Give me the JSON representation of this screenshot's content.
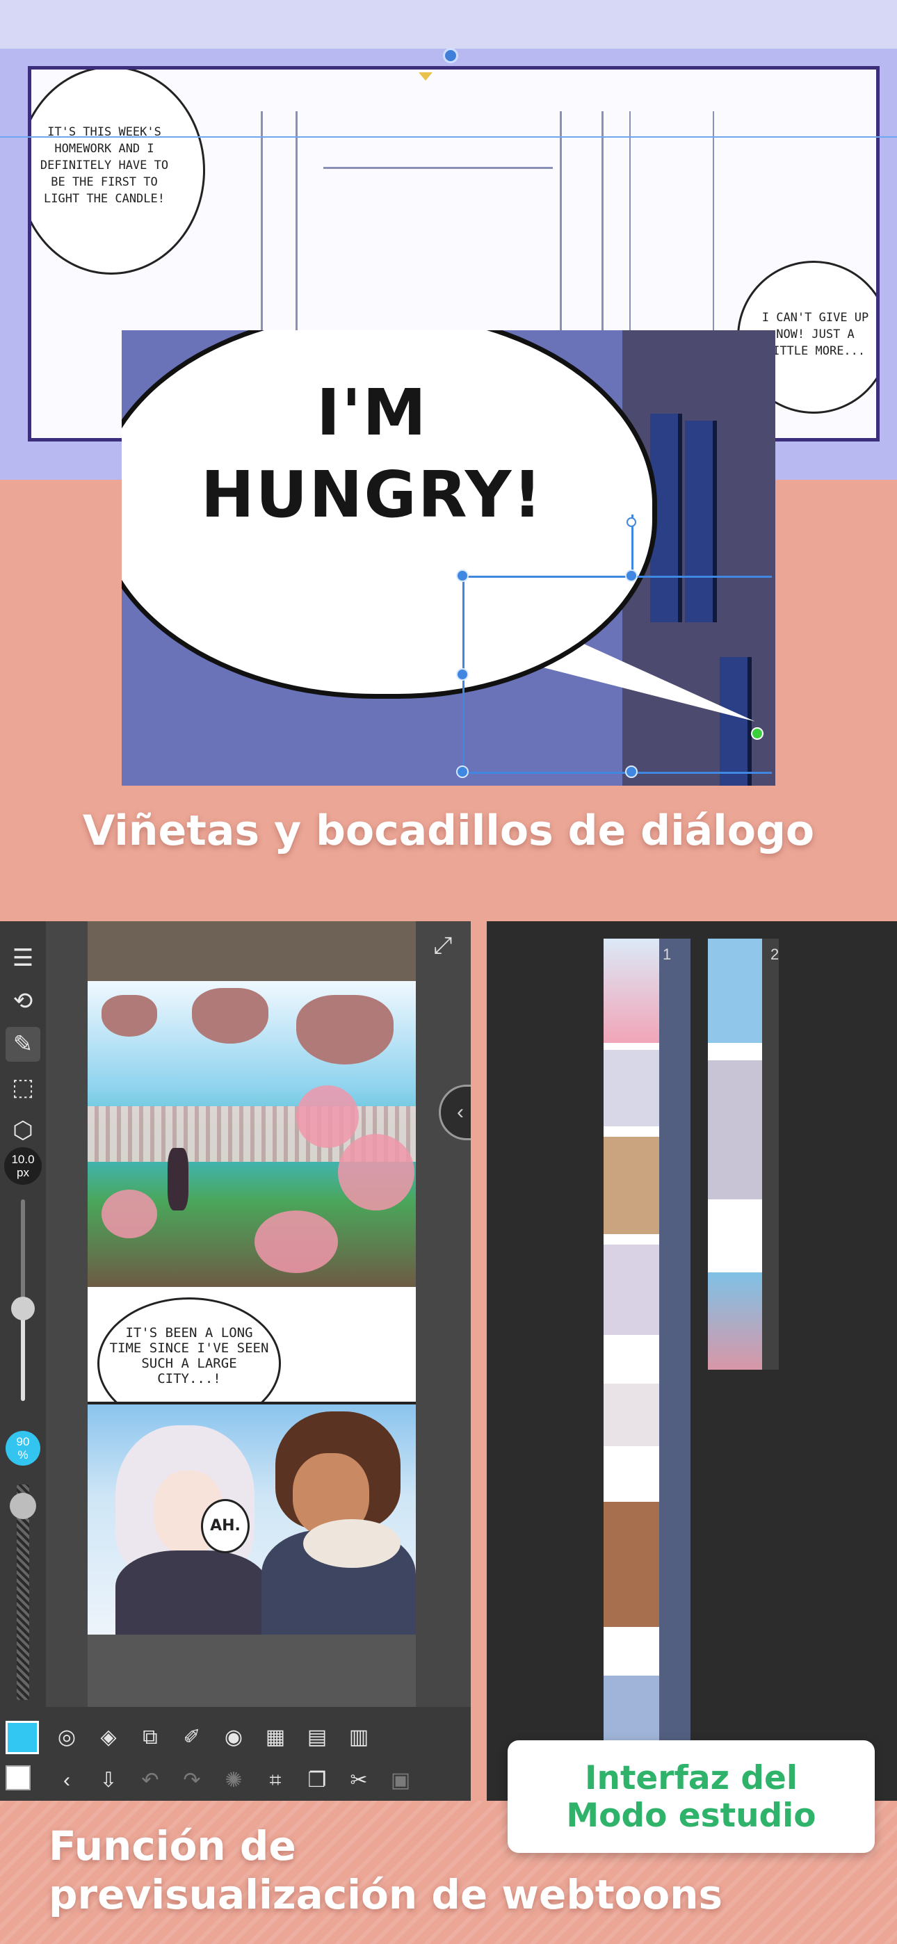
{
  "top_panel": {
    "bubble_left_text": "IT'S THIS WEEK'S HOMEWORK AND I DEFINITELY HAVE TO BE THE FIRST TO LIGHT THE CANDLE!",
    "bubble_right_text": "I CAN'T GIVE UP NOW! JUST A LITTLE MORE...",
    "zoom_text_line1": "I'M",
    "zoom_text_line2": "HUNGRY!",
    "caption": "Viñetas y bocadillos de diálogo"
  },
  "app": {
    "brush_size_value": "10.0",
    "brush_size_unit": "px",
    "opacity_value": "90",
    "opacity_unit": "%",
    "primary_color": "#32c6f2",
    "panel2_text": "IT'S BEEN A LONG TIME SINCE I'VE SEEN SUCH A LARGE CITY...!",
    "panel3_text": "AH.",
    "toolbar_icons": [
      "menu-icon",
      "transform-icon",
      "pen-icon",
      "selection-icon",
      "3d-object-icon"
    ],
    "bottom_row1_icons": [
      "navigator-icon",
      "layers-icon",
      "layer-settings-icon",
      "brush-settings-icon",
      "color-wheel-icon",
      "color-set-icon",
      "material-icon",
      "pages-icon"
    ],
    "bottom_row2_icons": [
      "back-icon",
      "import-icon",
      "undo-icon",
      "redo-icon",
      "loading-icon",
      "crop-icon",
      "copy-icon",
      "cut-icon",
      "paste-icon"
    ]
  },
  "studio": {
    "page1_label": "1",
    "page2_label": "2",
    "badge_line1": "Interfaz del",
    "badge_line2": "Modo estudio"
  },
  "bottom_caption": {
    "line1": "Función de",
    "line2": "previsualización de webtoons"
  },
  "colors": {
    "background": "#eba696",
    "accent_blue": "#32c6f2",
    "badge_green": "#2fb36a",
    "lineart_bg": "#b7b9f0"
  }
}
